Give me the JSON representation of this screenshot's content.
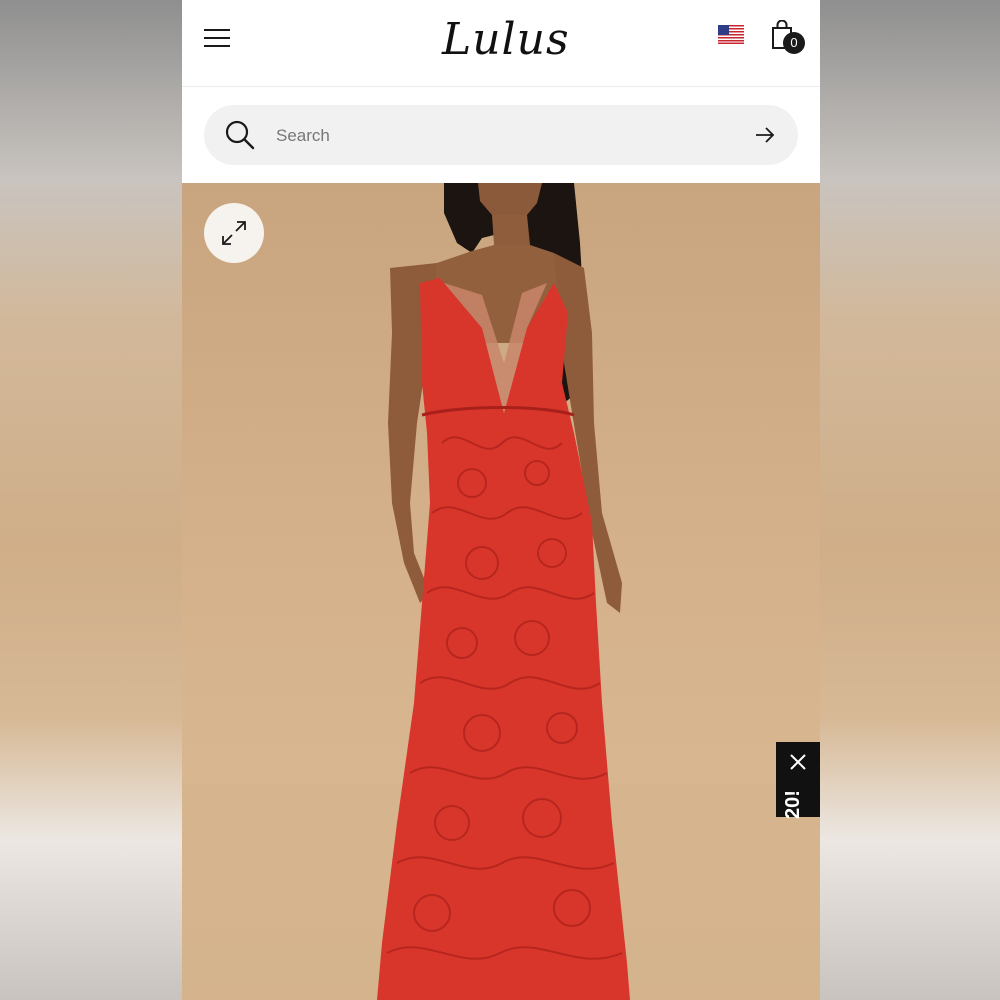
{
  "header": {
    "logo_text": "Lulus",
    "cart_count": "0",
    "icons": {
      "menu": "hamburger-menu-icon",
      "flag": "us-flag-icon",
      "bag": "shopping-bag-icon"
    }
  },
  "search": {
    "placeholder": "Search",
    "value": "",
    "icons": {
      "search": "search-icon",
      "submit": "arrow-right-icon"
    }
  },
  "product_gallery": {
    "icons": {
      "expand": "expand-icon"
    }
  },
  "promo_tab": {
    "text": "20!",
    "icons": {
      "close": "close-icon"
    }
  },
  "colors": {
    "background_top": "#8f8f8f",
    "backdrop": "#d4b08a",
    "dress_red": "#d8362b",
    "search_bg": "#f1f1f1",
    "text_dark": "#1a1a1a"
  }
}
